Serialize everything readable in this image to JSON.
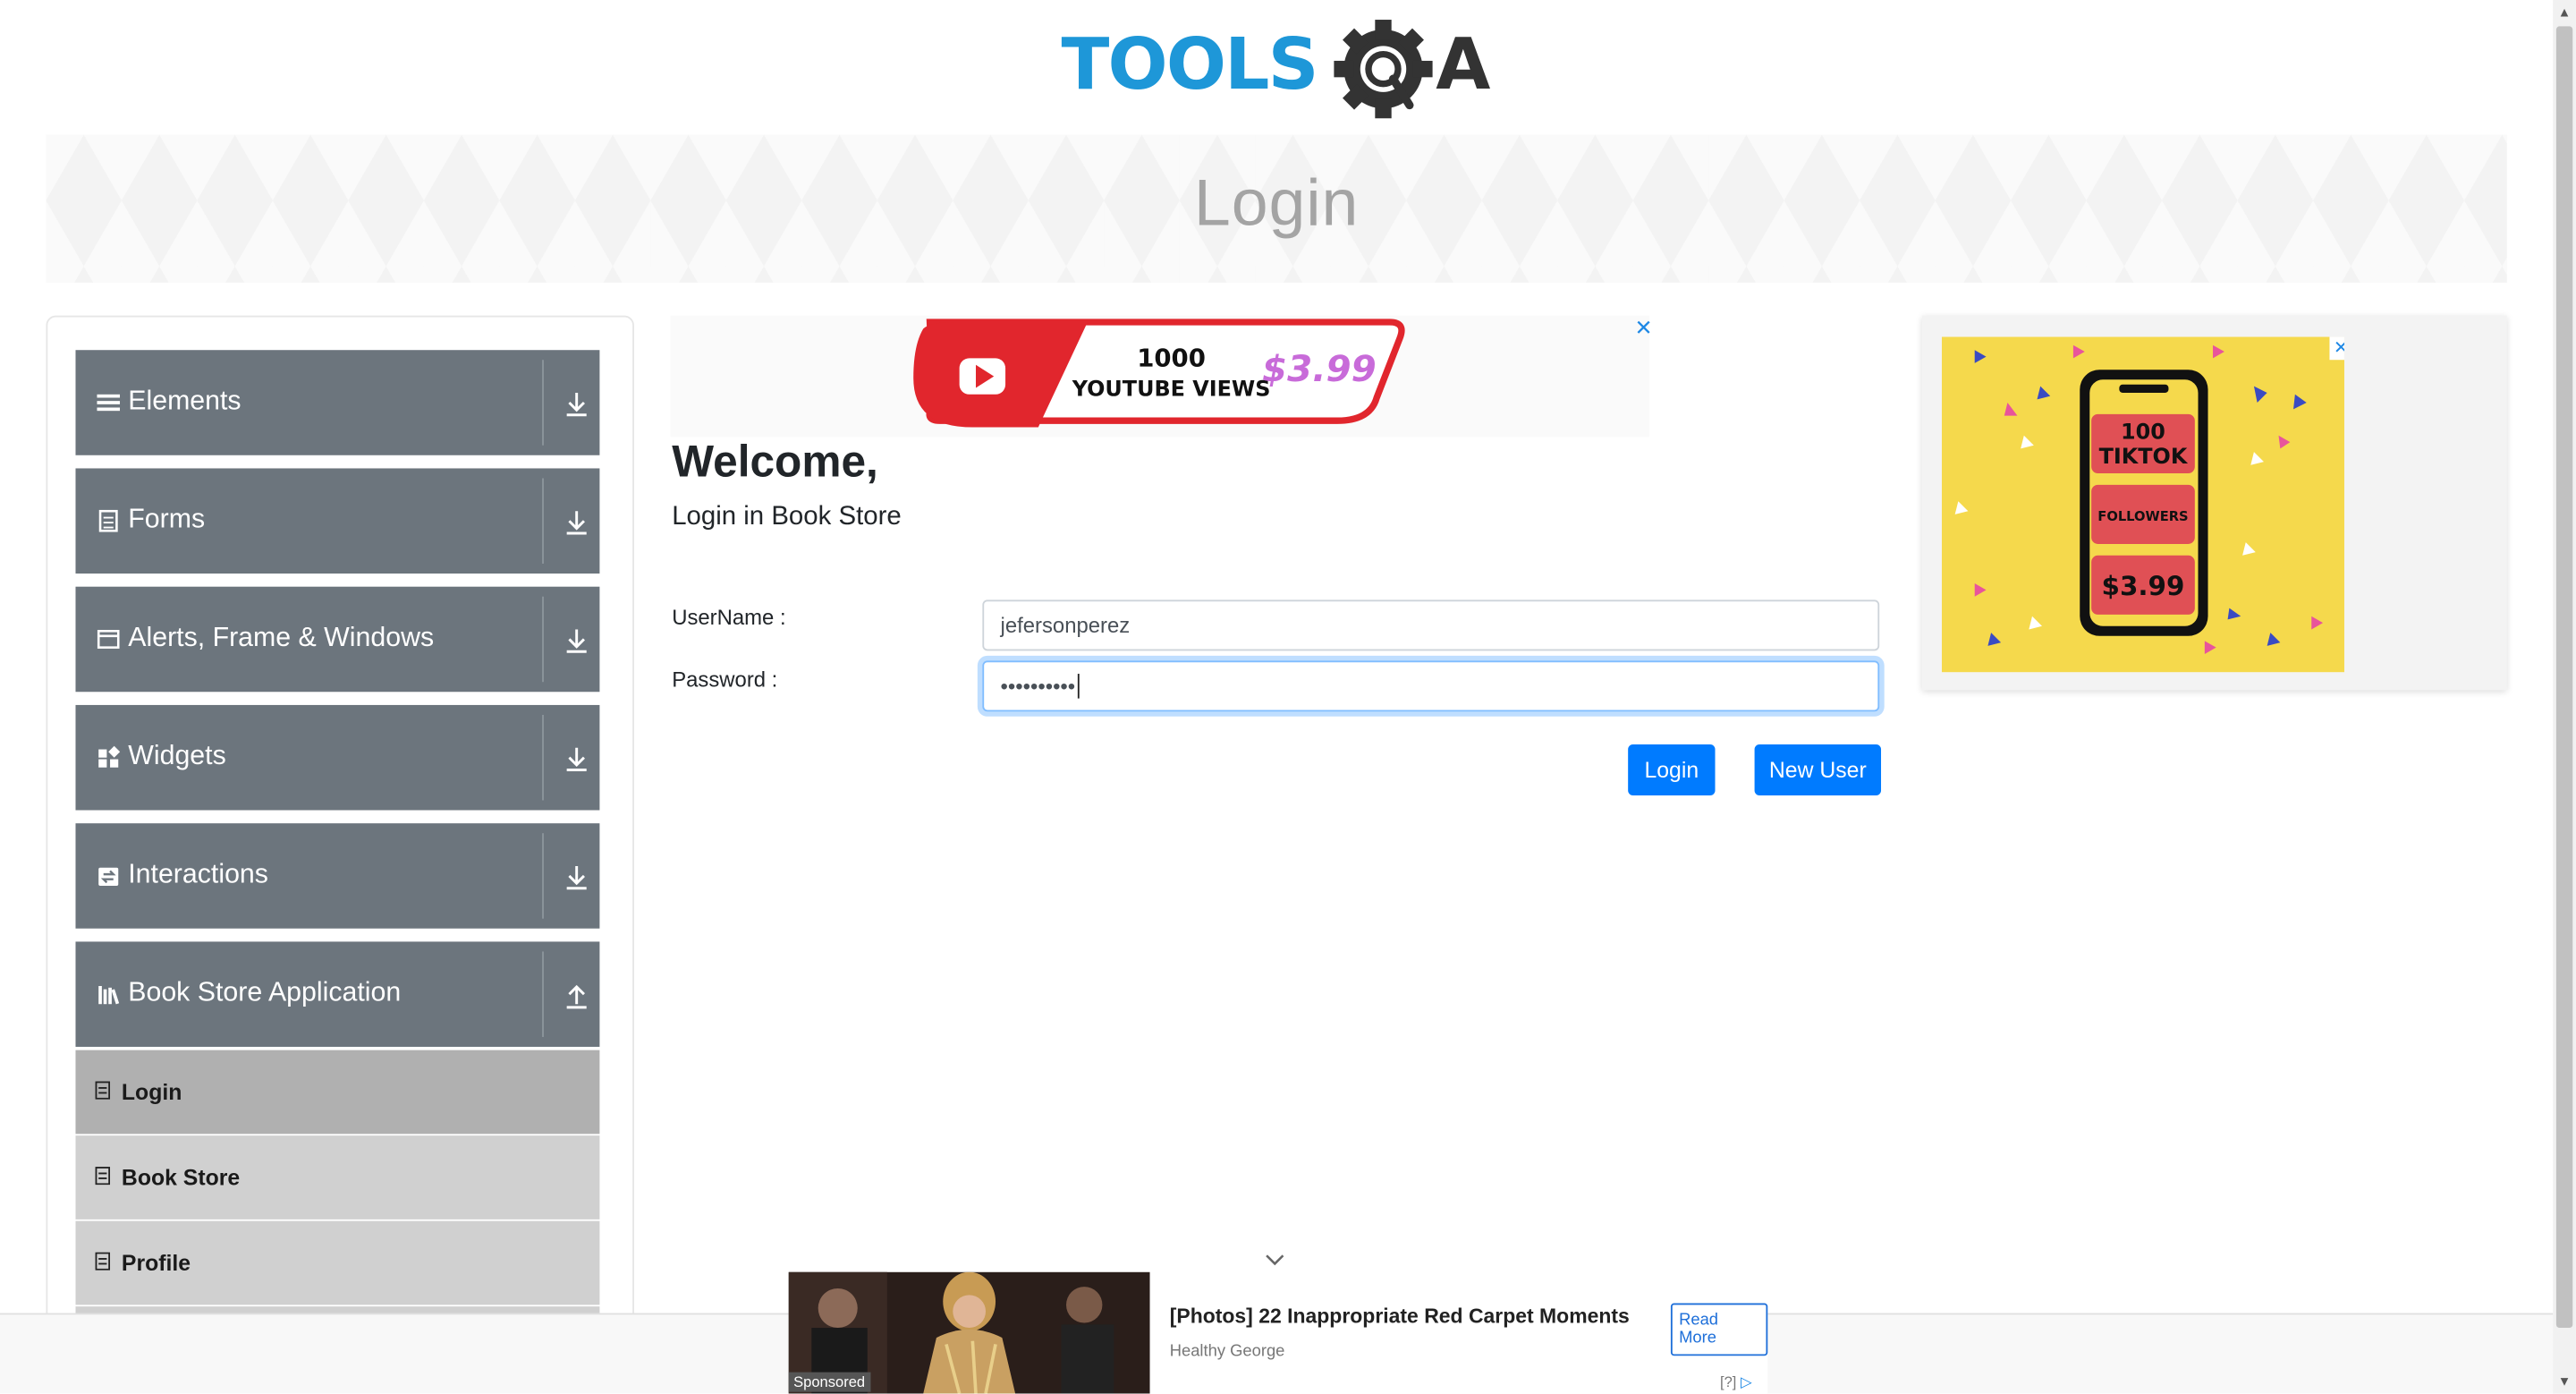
{
  "logo": {
    "text_tools": "TOOLS",
    "text_qa": "QA"
  },
  "header": {
    "title": "Login"
  },
  "sidebar": {
    "groups": [
      {
        "label": "Elements",
        "icon": "list-icon"
      },
      {
        "label": "Forms",
        "icon": "document-icon"
      },
      {
        "label": "Alerts, Frame & Windows",
        "icon": "window-icon"
      },
      {
        "label": "Widgets",
        "icon": "widgets-icon"
      },
      {
        "label": "Interactions",
        "icon": "interaction-icon"
      },
      {
        "label": "Book Store Application",
        "icon": "books-icon"
      }
    ],
    "book_store_items": [
      {
        "label": "Login",
        "active": true
      },
      {
        "label": "Book Store",
        "active": false
      },
      {
        "label": "Profile",
        "active": false
      }
    ]
  },
  "top_ad": {
    "line1": "1000",
    "line2": "YOUTUBE VIEWS",
    "price": "$3.99",
    "close": "✕"
  },
  "main": {
    "welcome": "Welcome,",
    "subtitle": "Login in Book Store",
    "username_label": "UserName :",
    "username_value": "jefersonperez",
    "password_label": "Password :",
    "password_value": "••••••••••",
    "login_button": "Login",
    "new_user_button": "New User"
  },
  "right_ad": {
    "line1": "100",
    "line2": "TIKTOK",
    "line3": "FOLLOWERS",
    "price": "$3.99",
    "close": "✕"
  },
  "bottom_ad": {
    "headline": "[Photos] 22 Inappropriate Red Carpet Moments",
    "source": "Healthy George",
    "read_more": "Read More",
    "sponsored": "Sponsored",
    "info": "[?]"
  },
  "colors": {
    "sidebar_group": "#6c757d",
    "primary": "#007bff",
    "sub_item": "#d0d0d0",
    "sub_active": "#b0b0b0"
  }
}
